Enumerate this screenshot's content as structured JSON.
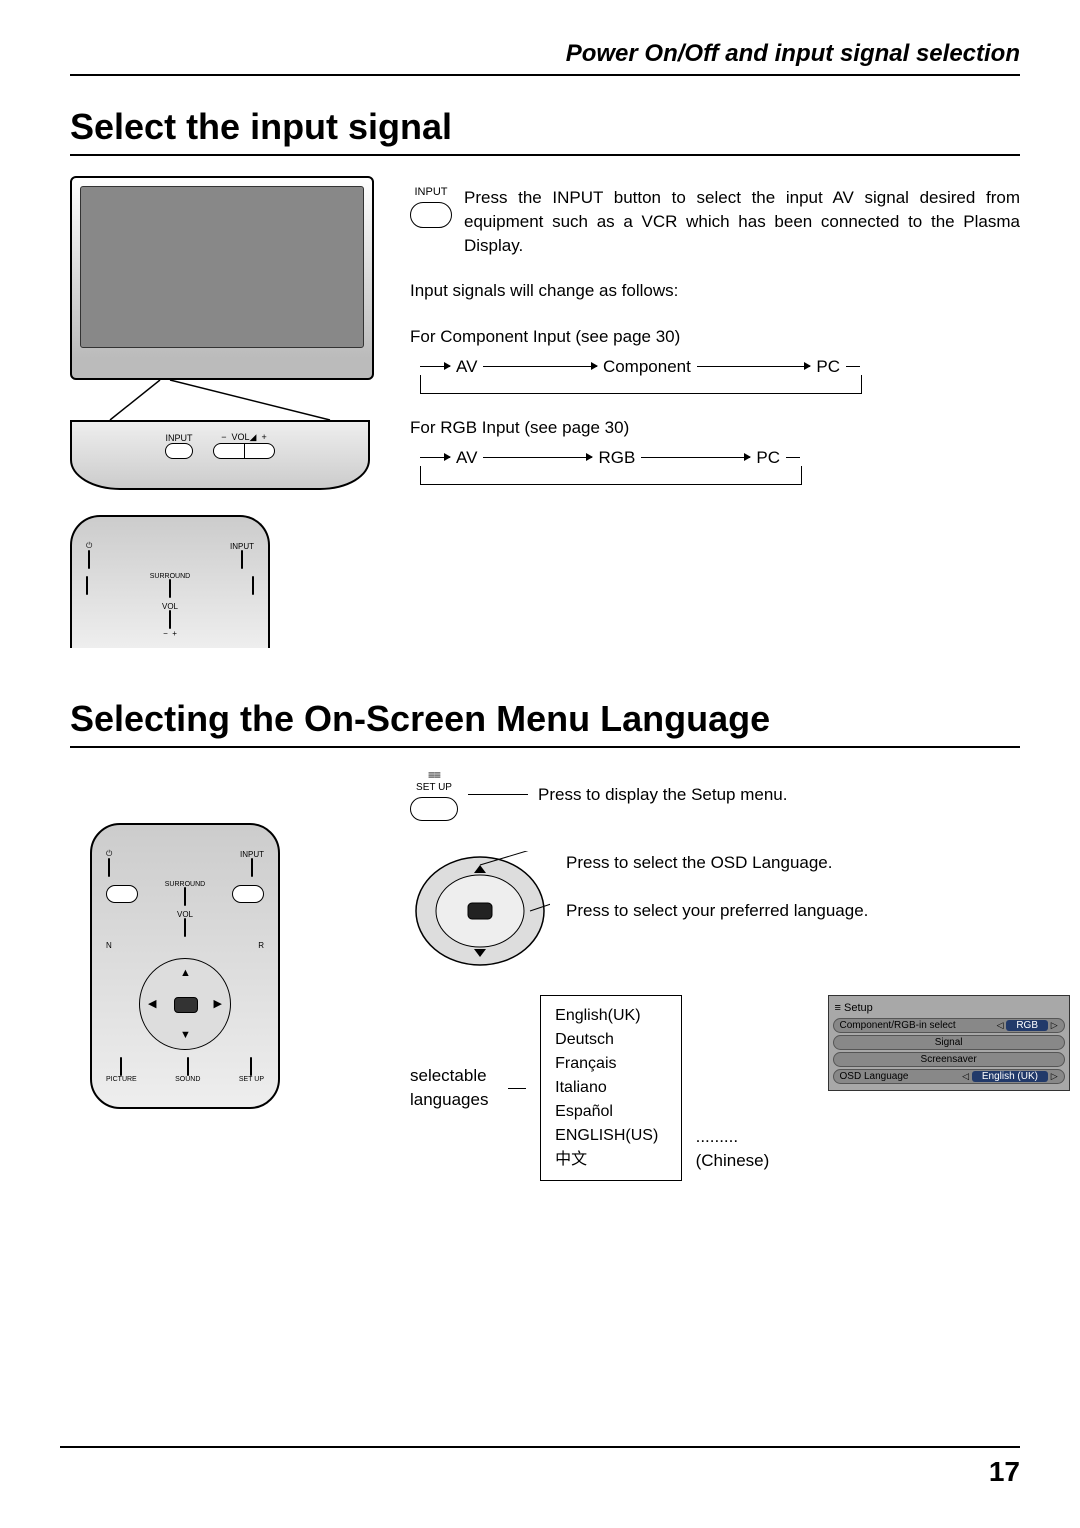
{
  "header": "Power On/Off and input signal selection",
  "section1": {
    "heading": "Select the input signal",
    "input_label": "INPUT",
    "press_text": "Press the INPUT button to select the input AV signal desired from equipment such as a VCR which has been connected to the Plasma Display.",
    "change_text": "Input signals will change as follows:",
    "component_line": "For Component Input (see page 30)",
    "rgb_line": "For RGB Input (see page 30)",
    "cycle1": {
      "a": "AV",
      "b": "Component",
      "c": "PC"
    },
    "cycle2": {
      "a": "AV",
      "b": "RGB",
      "c": "PC"
    },
    "panel": {
      "input": "INPUT",
      "vol": "VOL",
      "minus": "−",
      "plus": "+"
    },
    "remote": {
      "input": "INPUT",
      "surround": "SURROUND",
      "vol": "VOL",
      "minus": "−",
      "plus": "+"
    }
  },
  "section2": {
    "heading": "Selecting the On-Screen Menu Language",
    "setup_label": "SET UP",
    "step1": "Press to display the Setup menu.",
    "step2": "Press to select the OSD Language.",
    "step3": "Press to select your preferred language.",
    "selectable_label": "selectable languages",
    "languages": [
      "English(UK)",
      "Deutsch",
      "Français",
      "Italiano",
      "Español",
      "ENGLISH(US)",
      "中文"
    ],
    "chinese_note": ".........(Chinese)",
    "remote_labels": {
      "input": "INPUT",
      "surround": "SURROUND",
      "vol": "VOL",
      "n": "N",
      "r": "R",
      "picture": "PICTURE",
      "sound": "SOUND",
      "setup": "SET UP"
    },
    "osd": {
      "title": "Setup",
      "row1_label": "Component/RGB-in select",
      "row1_value": "RGB",
      "row2": "Signal",
      "row3": "Screensaver",
      "row4_label": "OSD  Language",
      "row4_value": "English (UK)"
    }
  },
  "page_number": "17"
}
